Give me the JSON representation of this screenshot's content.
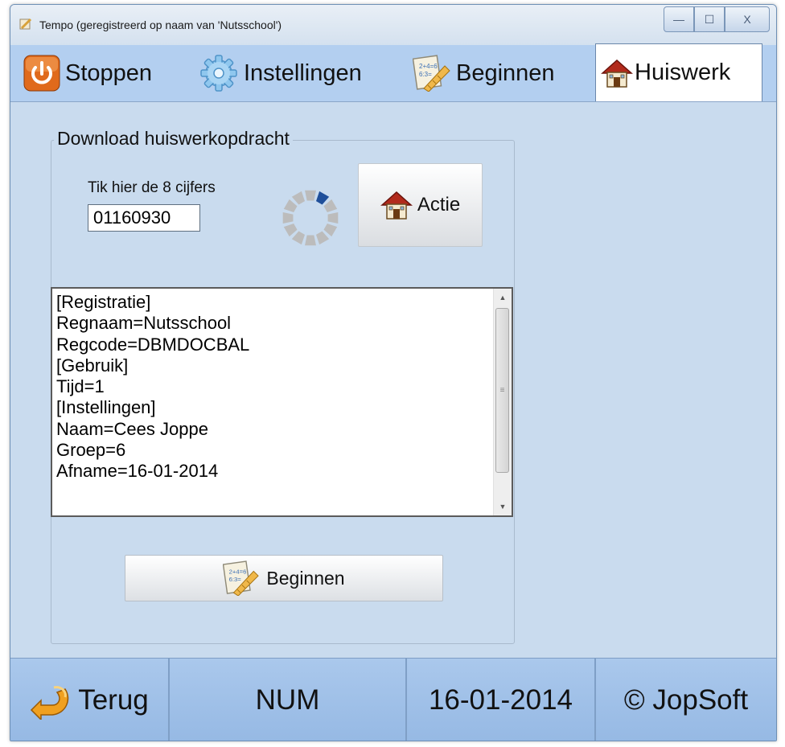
{
  "window": {
    "title": "Tempo (geregistreerd op naam van 'Nutsschool')",
    "controls": {
      "minimize_glyph": "—",
      "maximize_glyph": "☐",
      "close_glyph": "X"
    }
  },
  "tabs": [
    {
      "label": "Stoppen",
      "icon": "power-icon"
    },
    {
      "label": "Instellingen",
      "icon": "gear-icon"
    },
    {
      "label": "Beginnen",
      "icon": "worksheet-pencil-icon"
    },
    {
      "label": "Huiswerk",
      "icon": "house-icon",
      "active": true
    }
  ],
  "download": {
    "legend": "Download huiswerkopdracht",
    "code_label": "Tik hier de 8 cijfers",
    "code_value": "01160930",
    "action_label": "Actie"
  },
  "output_lines": [
    "[Registratie]",
    "Regnaam=Nutsschool",
    "Regcode=DBMDOCBAL",
    "[Gebruik]",
    "Tijd=1",
    "[Instellingen]",
    "Naam=Cees Joppe",
    "Groep=6",
    "Afname=16-01-2014"
  ],
  "begin_button": {
    "label": "Beginnen"
  },
  "status": {
    "back": "Terug",
    "num": "NUM",
    "date": "16-01-2014",
    "copyright": "© JopSoft"
  },
  "colors": {
    "background": "#c9dbee",
    "tabbar": "#b3cff0",
    "statusbar": "#a3c3ea",
    "accent_orange": "#e8912a",
    "spinner_active": "#1f4f9a",
    "spinner_idle": "#bcbcbc"
  }
}
